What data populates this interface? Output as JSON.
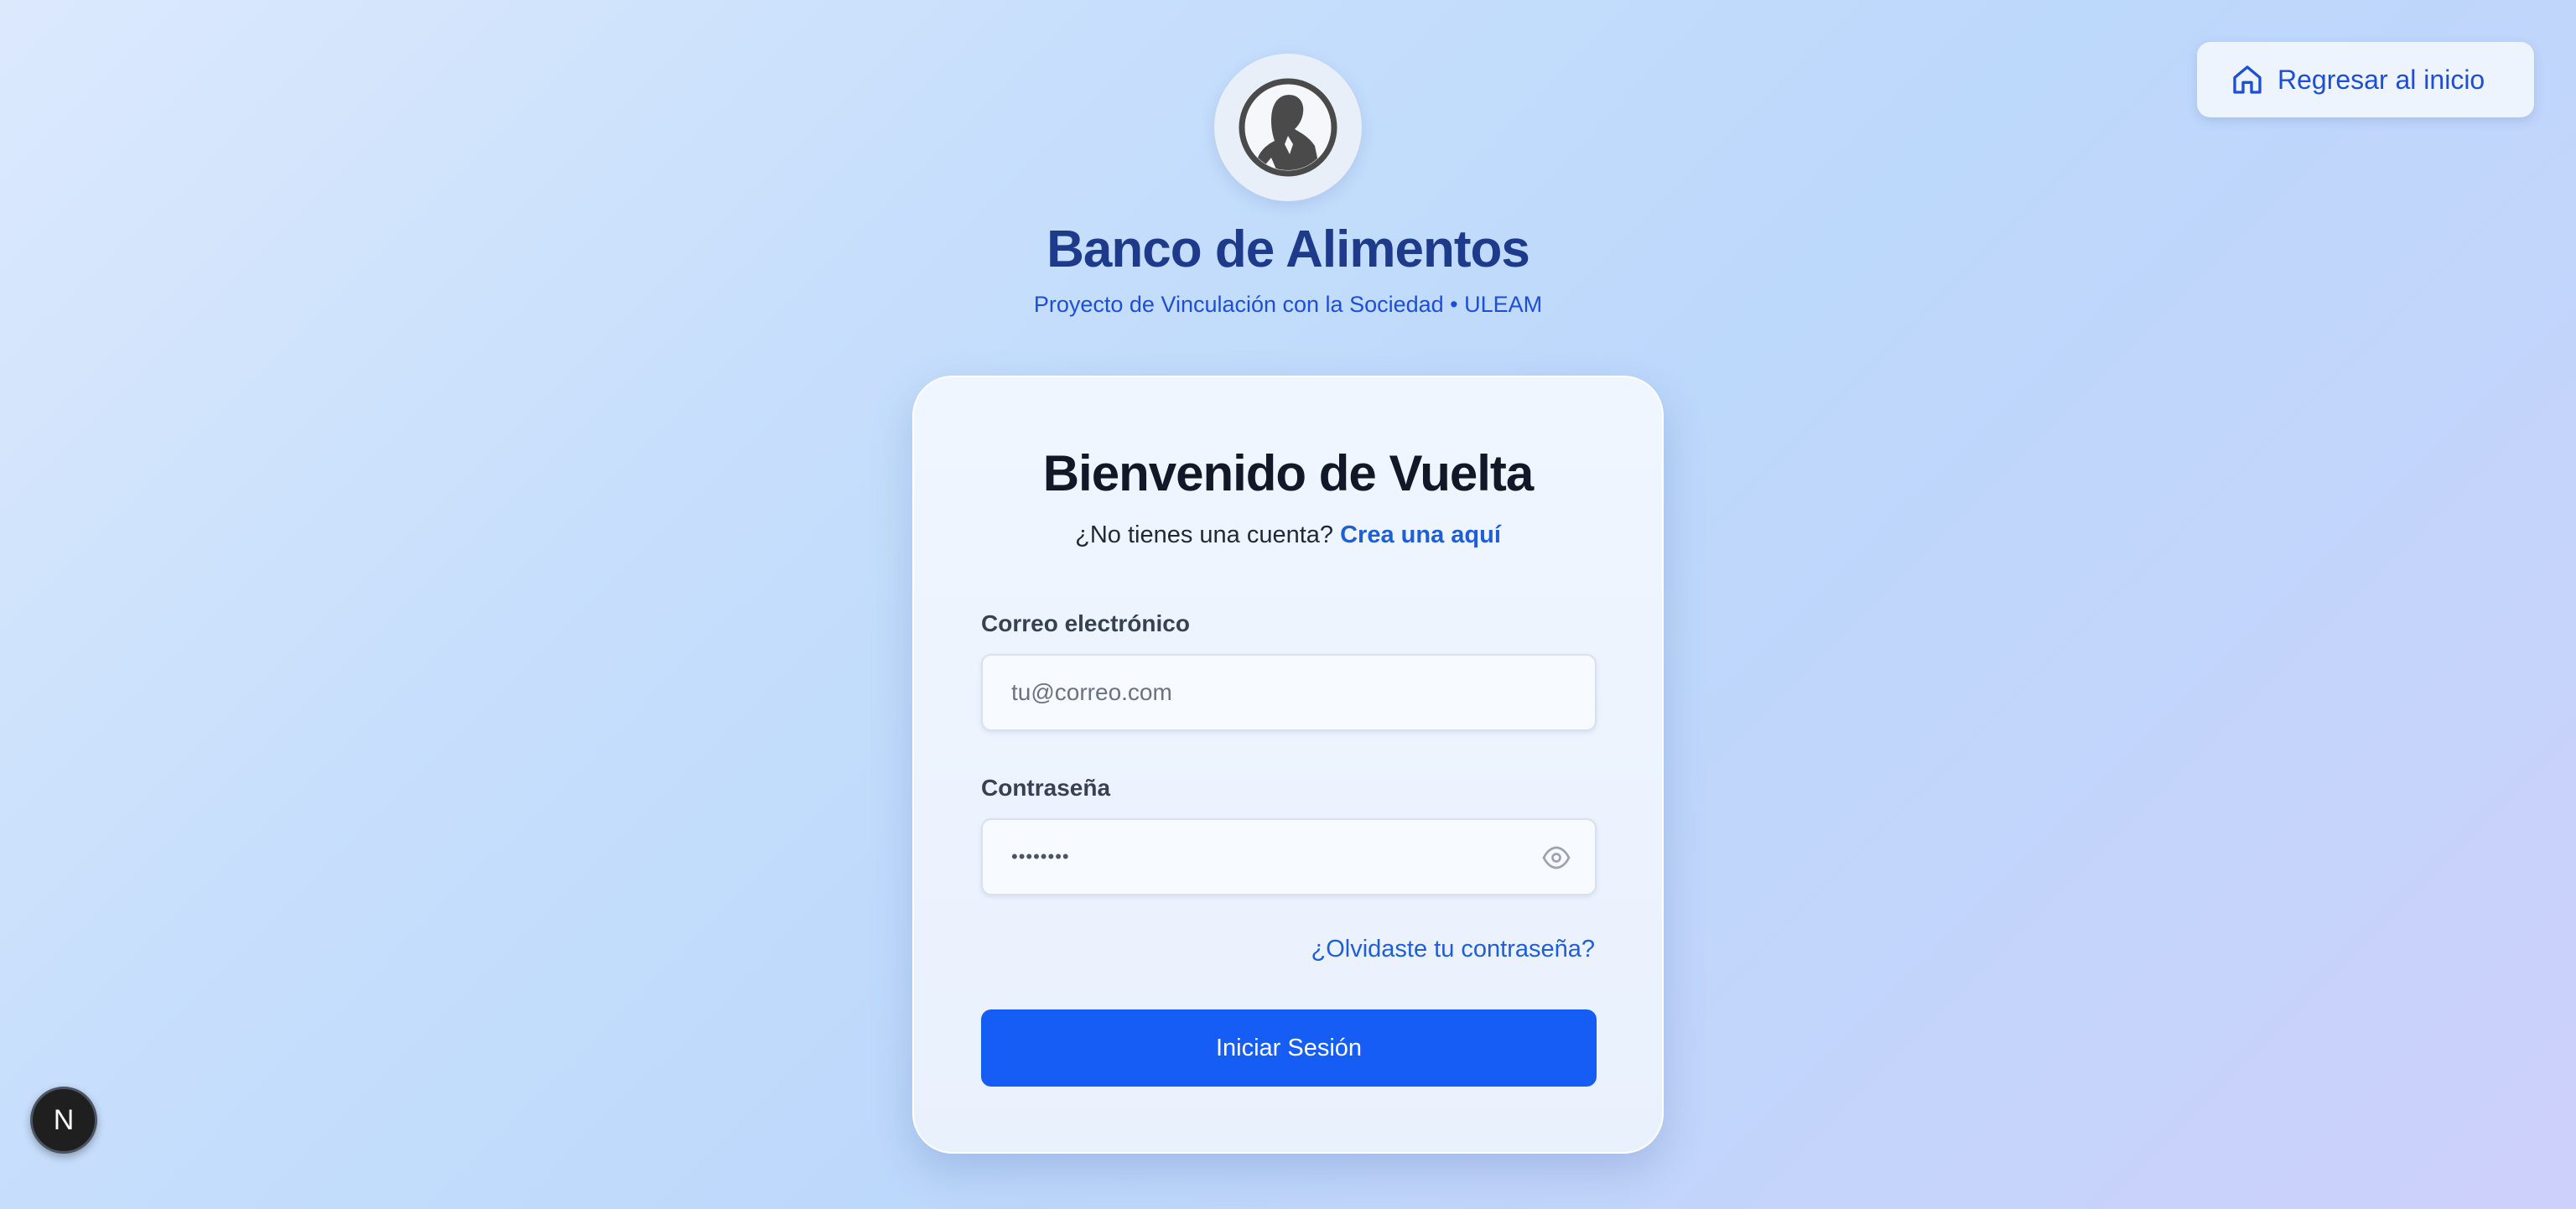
{
  "nav": {
    "home_label": "Regresar al inicio"
  },
  "brand": {
    "title": "Banco de Alimentos",
    "subtitle": "Proyecto de Vinculación con la Sociedad • ULEAM"
  },
  "login": {
    "title": "Bienvenido de Vuelta",
    "no_account_text": "¿No tienes una cuenta?",
    "create_link": "Crea una aquí",
    "email_label": "Correo electrónico",
    "email_placeholder": "tu@correo.com",
    "password_label": "Contraseña",
    "password_value": "••••••••",
    "forgot_link": "¿Olvidaste tu contraseña?",
    "submit_label": "Iniciar Sesión"
  },
  "dev_badge": {
    "label": "N"
  },
  "colors": {
    "primary": "#165df5",
    "link": "#1d5fd9",
    "brand_title": "#1e3a8a"
  },
  "icons": {
    "home": "home-icon",
    "eye": "eye-icon",
    "logo": "portrait-logo-icon"
  }
}
